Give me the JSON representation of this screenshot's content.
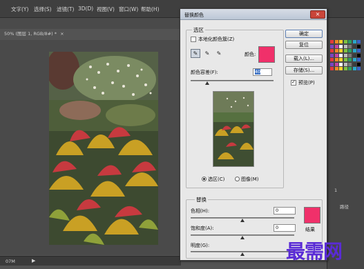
{
  "menubar": {
    "items": [
      "文字(Y)",
      "选择(S)",
      "滤镜(T)",
      "3D(D)",
      "视图(V)",
      "窗口(W)",
      "帮助(H)"
    ]
  },
  "document": {
    "tab_label": "50% (图层 1, RGB/8#) *",
    "tab_close": "×"
  },
  "statusbar": {
    "zoom": "07M"
  },
  "rpanel": {
    "layer_label": "1",
    "paths_label": "路径"
  },
  "dialog": {
    "title": "替换颜色",
    "close": "×",
    "selection": {
      "group_label": "选区",
      "localized_clusters_label": "本地化颜色簇(Z)",
      "localized_clusters_checked": false,
      "color_label": "颜色:",
      "color_hex": "#f0306a",
      "fuzziness_label": "颜色容差(F):",
      "fuzziness_value": "40",
      "fuzziness_level": 0.2,
      "view_selection_label": "选区(C)",
      "view_image_label": "图像(M)",
      "view_selected": "selection"
    },
    "replacement": {
      "group_label": "替换",
      "hue_label": "色相(H):",
      "hue_value": "0",
      "saturation_label": "饱和度(A):",
      "saturation_value": "0",
      "lightness_label": "明度(G):",
      "lightness_value": "",
      "result_label": "结果",
      "result_hex": "#f0306a"
    },
    "buttons": {
      "ok": "确定",
      "reset": "复位",
      "load": "载入(L)...",
      "save": "存储(S)..."
    },
    "preview": {
      "label": "预览(P)",
      "checked": true
    }
  },
  "watermark": "最需网",
  "colors": {
    "accent": "#f0306a",
    "watermark": "#5a2bd6"
  }
}
